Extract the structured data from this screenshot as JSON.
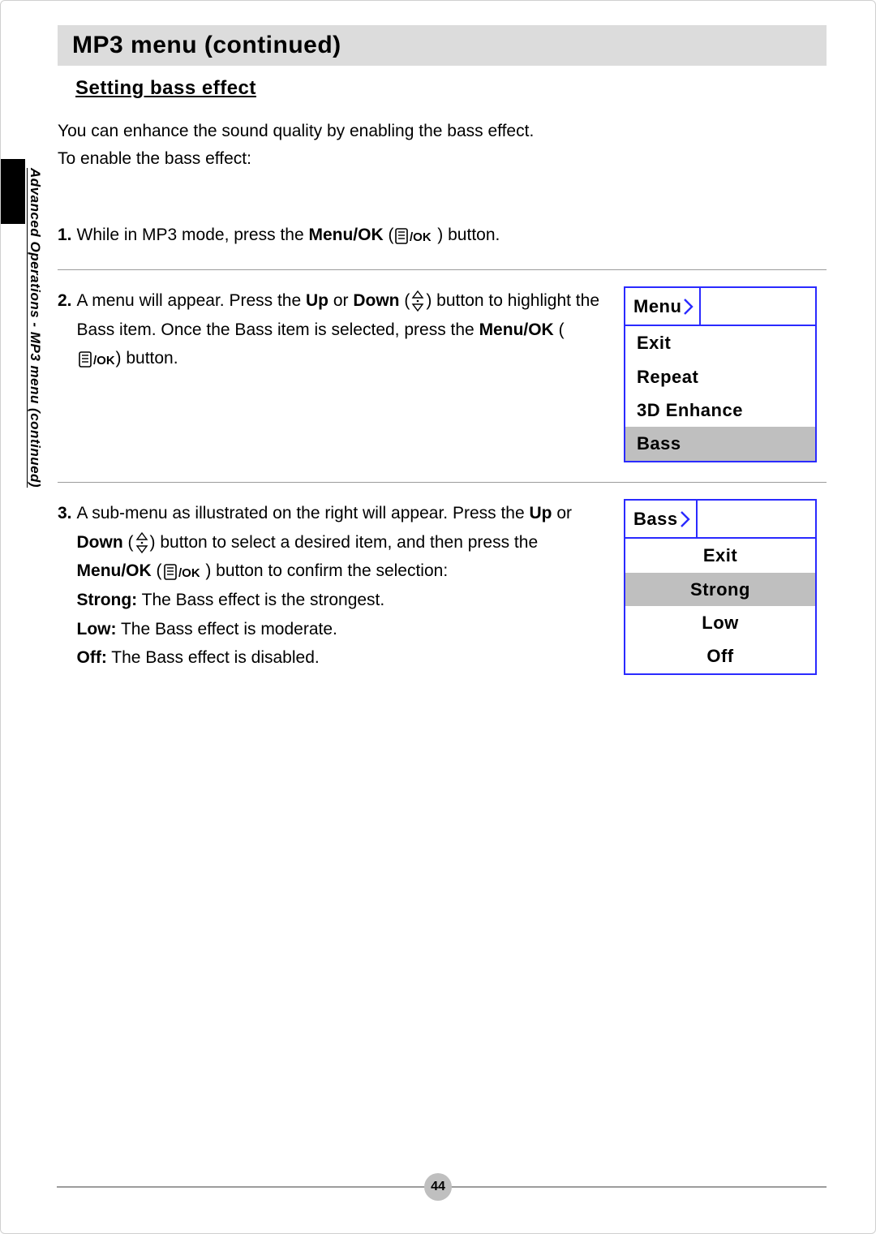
{
  "sidebar_label": "Advanced Operations - MP3 menu (continued)",
  "title": "MP3 menu (continued)",
  "subheading": "Setting bass effect",
  "intro_line1": "You can enhance the sound quality by enabling the bass effect.",
  "intro_line2": "To enable the bass effect:",
  "step1": {
    "num": "1.",
    "pre": " While in MP3 mode, press the ",
    "menu_ok": "Menu/OK",
    "post": " button."
  },
  "step2": {
    "num": "2.",
    "pre": " A menu will appear. Press the ",
    "up": "Up",
    "or": " or ",
    "down": "Down",
    "mid": " button to highlight the Bass item. Once the Bass item is selected, press the ",
    "menu_ok": "Menu/OK",
    "post": " button.",
    "menu_tab": "Menu",
    "items": [
      "Exit",
      "Repeat",
      "3D Enhance",
      "Bass"
    ],
    "highlight_index": 3
  },
  "step3": {
    "num": "3.",
    "pre": " A sub-menu as illustrated on the right will appear. Press the ",
    "up": "Up",
    "or": " or ",
    "down": "Down",
    "mid1": " button to select a desired item, and then press the ",
    "menu_ok": "Menu/OK",
    "mid2": " button to confirm the selection:",
    "opt_strong_label": "Strong:",
    "opt_strong_desc": " The Bass effect is the strongest.",
    "opt_low_label": "Low:",
    "opt_low_desc": " The Bass effect is moderate.",
    "opt_off_label": "Off:",
    "opt_off_desc": " The Bass effect is disabled.",
    "menu_tab": "Bass",
    "items": [
      "Exit",
      "Strong",
      "Low",
      "Off"
    ],
    "highlight_index": 1
  },
  "page_number": "44"
}
